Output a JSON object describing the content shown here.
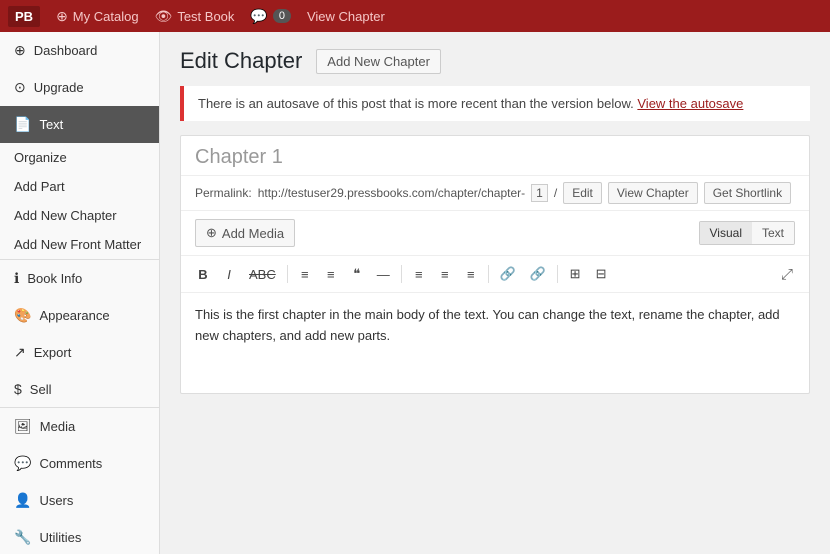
{
  "topbar": {
    "logo": "PB",
    "items": [
      {
        "id": "my-catalog",
        "label": "My Catalog",
        "icon": "⊕"
      },
      {
        "id": "test-book",
        "label": "Test Book",
        "icon": "👁"
      },
      {
        "id": "comments",
        "label": "0",
        "icon": "💬"
      },
      {
        "id": "view-chapter",
        "label": "View Chapter",
        "icon": ""
      }
    ]
  },
  "sidebar": {
    "items": [
      {
        "id": "dashboard",
        "label": "Dashboard",
        "icon": "⊕",
        "type": "main"
      },
      {
        "id": "upgrade",
        "label": "Upgrade",
        "icon": "⊙",
        "type": "main"
      },
      {
        "id": "text",
        "label": "Text",
        "icon": "📄",
        "type": "main",
        "active": true
      },
      {
        "id": "organize",
        "label": "Organize",
        "type": "sub"
      },
      {
        "id": "add-part",
        "label": "Add Part",
        "type": "sub"
      },
      {
        "id": "add-new-chapter",
        "label": "Add New Chapter",
        "type": "sub"
      },
      {
        "id": "add-new-front-matter",
        "label": "Add New Front Matter",
        "type": "sub"
      },
      {
        "id": "book-info",
        "label": "Book Info",
        "icon": "ℹ",
        "type": "main"
      },
      {
        "id": "appearance",
        "label": "Appearance",
        "icon": "🎨",
        "type": "main"
      },
      {
        "id": "export",
        "label": "Export",
        "icon": "↗",
        "type": "main"
      },
      {
        "id": "sell",
        "label": "Sell",
        "icon": "$",
        "type": "main"
      },
      {
        "id": "media",
        "label": "Media",
        "icon": "🖼",
        "type": "main"
      },
      {
        "id": "comments",
        "label": "Comments",
        "icon": "💬",
        "type": "main"
      },
      {
        "id": "users",
        "label": "Users",
        "icon": "👤",
        "type": "main"
      },
      {
        "id": "utilities",
        "label": "Utilities",
        "icon": "🔧",
        "type": "main"
      }
    ]
  },
  "main": {
    "page_title": "Edit Chapter",
    "add_chapter_btn": "Add New Chapter",
    "autosave_notice": "There is an autosave of this post that is more recent than the version below.",
    "autosave_link": "View the autosave",
    "chapter_title": "Chapter 1",
    "permalink_label": "Permalink:",
    "permalink_url": "http://testuser29.pressbooks.com/chapter/chapter-",
    "permalink_id": "1",
    "permalink_slash": "/",
    "btn_edit": "Edit",
    "btn_view_chapter": "View Chapter",
    "btn_get_shortlink": "Get Shortlink",
    "btn_add_media": "Add Media",
    "btn_visual": "Visual",
    "btn_text": "Text",
    "toolbar": {
      "buttons": [
        "B",
        "I",
        "ABC",
        "≡",
        "≡",
        "❝",
        "—",
        "≡",
        "≡",
        "≡",
        "🔗",
        "🔗",
        "⊞",
        "⊟"
      ]
    },
    "editor_content": "This is the first chapter in the main body of the text. You can change the text, rename the chapter, add new chapters, and add new parts."
  }
}
